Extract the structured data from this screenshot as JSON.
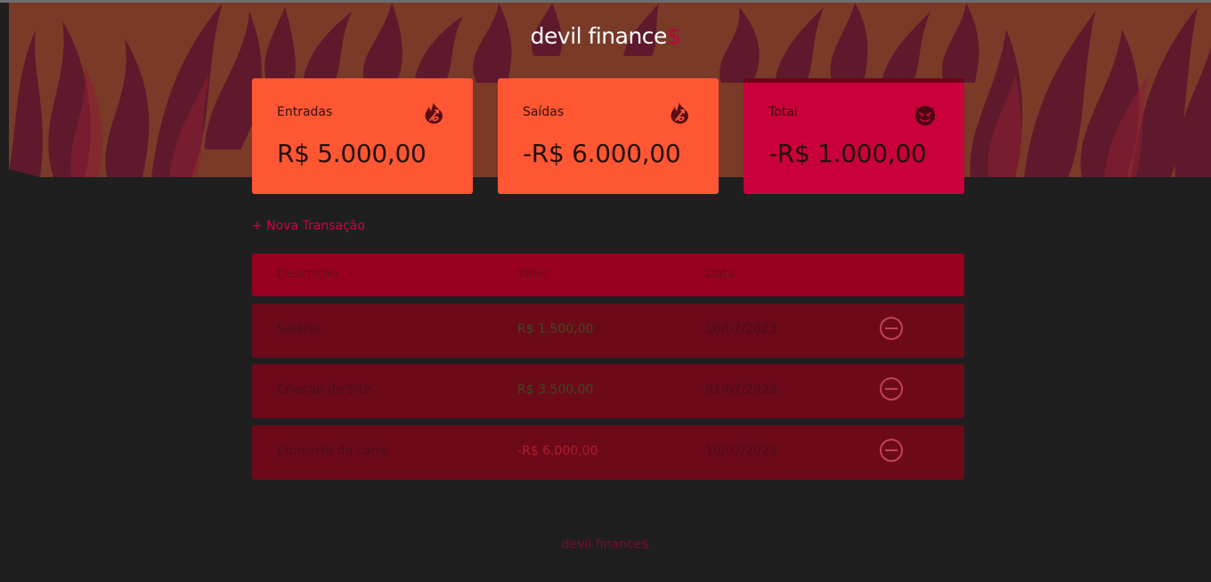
{
  "header": {
    "logo_text": "devil finance",
    "logo_symbol": "$"
  },
  "summary": {
    "income": {
      "label": "Entradas",
      "value": "R$ 5.000,00",
      "icon": "fire-pitchfork-icon"
    },
    "expense": {
      "label": "Saídas",
      "value": "-R$ 6.000,00",
      "icon": "fire-pitchfork-icon"
    },
    "total": {
      "label": "Total",
      "value": "-R$ 1.000,00",
      "icon": "devil-face-icon"
    }
  },
  "actions": {
    "new_transaction": "+ Nova Transação"
  },
  "table": {
    "headers": [
      "Descrição",
      "Valor",
      "Data"
    ],
    "rows": [
      {
        "description": "Salário",
        "amount": "R$ 1.500,00",
        "date": "10/07/2023",
        "type": "income"
      },
      {
        "description": "Criação de Site",
        "amount": "R$ 3.500,00",
        "date": "01/07/2023",
        "type": "income"
      },
      {
        "description": "Conserto do carro",
        "amount": "-R$ 6.000,00",
        "date": "10/07/2023",
        "type": "expense"
      }
    ]
  },
  "footer": {
    "text": "devil.finance$"
  },
  "colors": {
    "background": "#1f1f1f",
    "card_orange": "#ff5733",
    "card_red": "#c9003c",
    "accent": "#d6003f",
    "table_header": "#990020",
    "table_row": "#6c0a1a"
  }
}
